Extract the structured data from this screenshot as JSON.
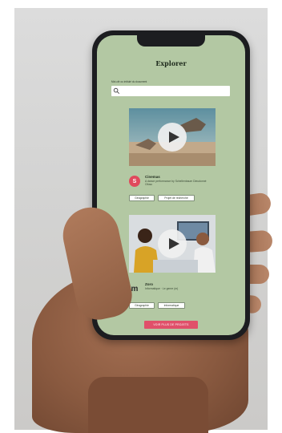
{
  "app": {
    "title": "Explorer",
    "search_label": "Mot-clé ou intitulé du document",
    "search_placeholder": ""
  },
  "cards": [
    {
      "avatar_letter": "S",
      "avatar_color": "#e04a5c",
      "title": "Cinemas",
      "description": "A dance performance by Schellenbaum Dieudonné Ofosu",
      "tags": [
        "Géographie",
        "Projet de recherche"
      ],
      "media_icon": "play-icon"
    },
    {
      "avatar_letter": "m",
      "avatar_color": "#3a3a3a",
      "title": "Zoro",
      "description": "Informatique · Le genre (m)",
      "tags": [
        "Géographie",
        "Informatique"
      ],
      "media_icon": "play-icon"
    }
  ],
  "footer": {
    "more_label": "VOIR PLUS DE PROJETS"
  },
  "colors": {
    "screen_bg": "#b3c8a3",
    "accent": "#e0506a"
  }
}
